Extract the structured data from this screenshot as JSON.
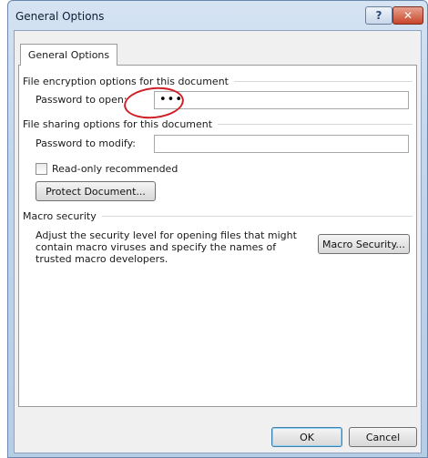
{
  "dialog": {
    "title": "General Options",
    "help_glyph": "?",
    "close_glyph": "✕"
  },
  "tab": {
    "label": "General Options"
  },
  "encryption": {
    "group_label": "File encryption options for this document",
    "open_label": "Password to open:",
    "open_value": "•••"
  },
  "sharing": {
    "group_label": "File sharing options for this document",
    "modify_label": "Password to modify:",
    "modify_value": "",
    "readonly_label": "Read-only recommended",
    "readonly_checked": false,
    "protect_button": "Protect Document..."
  },
  "macro": {
    "group_label": "Macro security",
    "description_lines": [
      "Adjust the security level for opening files that might",
      "contain macro viruses and specify the names of",
      "trusted macro developers."
    ],
    "button": "Macro Security..."
  },
  "footer": {
    "ok": "OK",
    "cancel": "Cancel"
  },
  "colors": {
    "frame": "#c2d6ec",
    "close_button": "#c7462b",
    "annotation": "#cf2027"
  }
}
